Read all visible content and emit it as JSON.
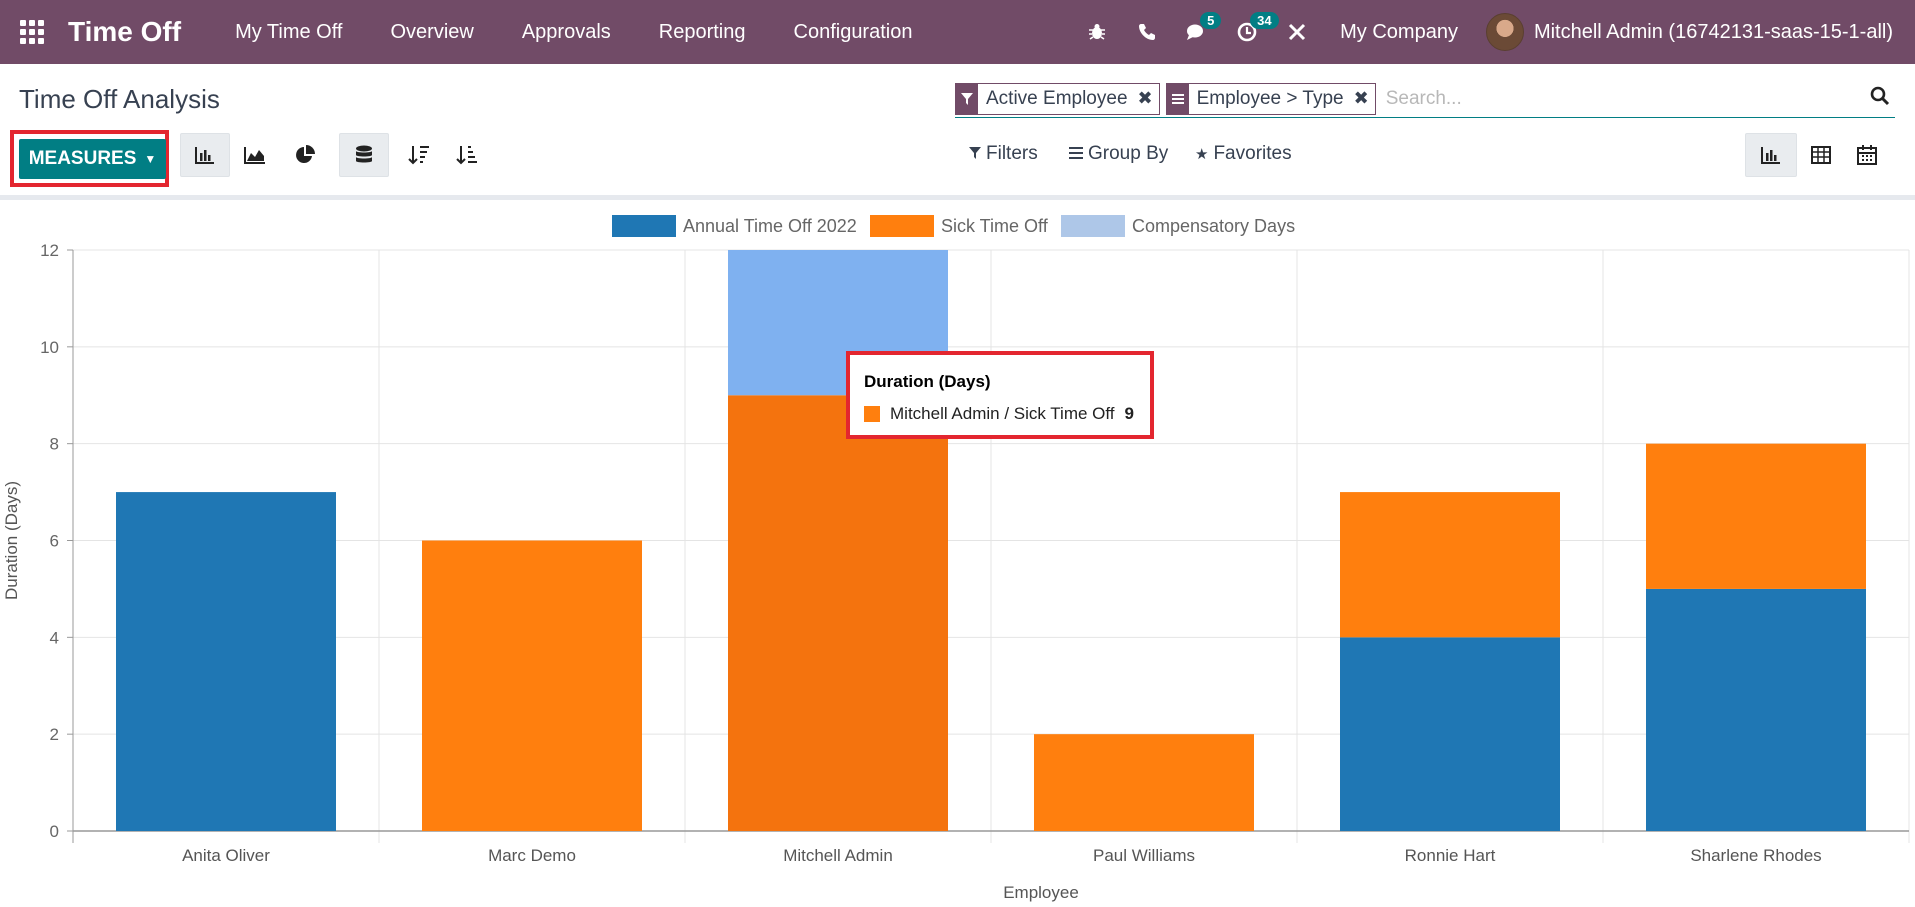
{
  "navbar": {
    "app_title": "Time Off",
    "menu": [
      "My Time Off",
      "Overview",
      "Approvals",
      "Reporting",
      "Configuration"
    ],
    "messages_badge": "5",
    "activities_badge": "34",
    "company": "My Company",
    "user": "Mitchell Admin (16742131-saas-15-1-all)",
    "accent_color": "#714b67"
  },
  "control_panel": {
    "title": "Time Off Analysis",
    "facets": [
      "Active Employee",
      "Employee > Type"
    ],
    "search_placeholder": "Search...",
    "measures_label": "MEASURES",
    "filters_label": "Filters",
    "group_by_label": "Group By",
    "favorites_label": "Favorites",
    "active_view": "graph",
    "active_chart_mode": "bar",
    "stacked": true
  },
  "chart_data": {
    "type": "bar",
    "stacked": true,
    "categories": [
      "Anita Oliver",
      "Marc Demo",
      "Mitchell Admin",
      "Paul Williams",
      "Ronnie Hart",
      "Sharlene Rhodes"
    ],
    "series": [
      {
        "name": "Annual Time Off 2022",
        "color": "#1f77b4",
        "values": [
          7,
          0,
          0,
          0,
          4,
          5
        ]
      },
      {
        "name": "Sick Time Off",
        "color": "#ff7f0e",
        "values": [
          0,
          6,
          9,
          2,
          3,
          3
        ]
      },
      {
        "name": "Compensatory Days",
        "color": "#aec7e8",
        "values": [
          0,
          0,
          3,
          0,
          0,
          0
        ]
      }
    ],
    "xlabel": "Employee",
    "ylabel": "Duration (Days)",
    "ylim": [
      0,
      12
    ],
    "yticks": [
      0,
      2,
      4,
      6,
      8,
      10,
      12
    ],
    "grid": true,
    "legend_position": "top-center"
  },
  "tooltip": {
    "title": "Duration (Days)",
    "label": "Mitchell Admin / Sick Time Off",
    "value": "9"
  }
}
